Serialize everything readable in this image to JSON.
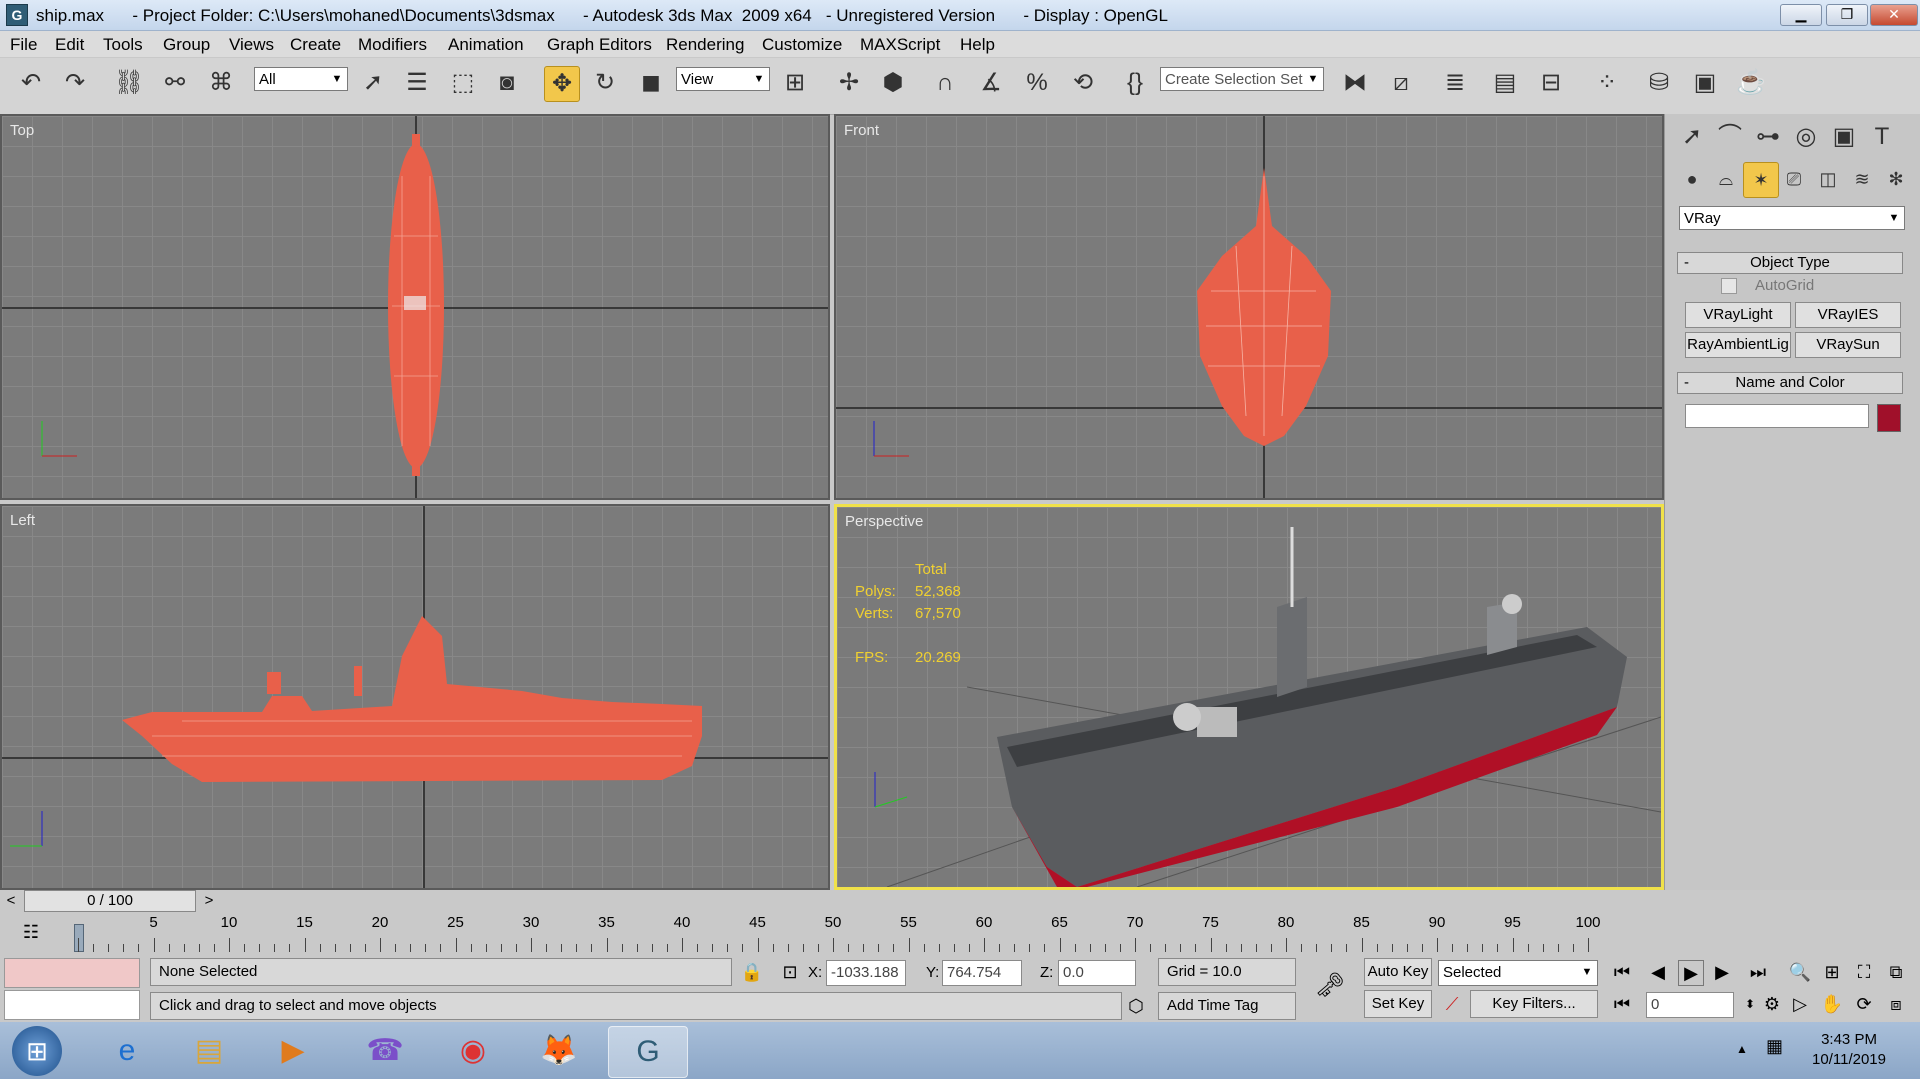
{
  "window": {
    "title": "ship.max      - Project Folder: C:\\Users\\mohaned\\Documents\\3dsmax      - Autodesk 3ds Max  2009 x64   - Unregistered Version      - Display : OpenGL",
    "minimize": "▁",
    "maximize": "❐",
    "close": "✕"
  },
  "menu": [
    "File",
    "Edit",
    "Tools",
    "Group",
    "Views",
    "Create",
    "Modifiers",
    "Animation",
    "Graph Editors",
    "Rendering",
    "Customize",
    "MAXScript",
    "Help"
  ],
  "toolbar": {
    "selection_filter": "All",
    "reference_coord": "View",
    "selection_set_placeholder": "Create Selection Set"
  },
  "viewports": {
    "top": "Top",
    "front": "Front",
    "left": "Left",
    "perspective": "Perspective",
    "stats": {
      "header": "Total",
      "polys_label": "Polys:",
      "polys_value": "52,368",
      "verts_label": "Verts:",
      "verts_value": "67,570",
      "fps_label": "FPS:",
      "fps_value": "20.269"
    }
  },
  "command_panel": {
    "category": "VRay",
    "object_type_title": "Object Type",
    "autogrid": "AutoGrid",
    "buttons": [
      "VRayLight",
      "VRayIES",
      "RayAmbientLig",
      "VRaySun"
    ],
    "name_color_title": "Name and Color",
    "name_value": "",
    "swatch_color": "#a0102a"
  },
  "timeline": {
    "position": "0 / 100",
    "ticks": [
      "5",
      "10",
      "15",
      "20",
      "25",
      "30",
      "35",
      "40",
      "45",
      "50",
      "55",
      "60",
      "65",
      "70",
      "75",
      "80",
      "85",
      "90",
      "95",
      "100"
    ]
  },
  "status": {
    "selection": "None Selected",
    "prompt": "Click and drag to select and move objects",
    "x_label": "X:",
    "x_value": "-1033.188",
    "y_label": "Y:",
    "y_value": "764.754",
    "z_label": "Z:",
    "z_value": "0.0",
    "grid": "Grid = 10.0",
    "add_time_tag": "Add Time Tag",
    "auto_key": "Auto Key",
    "set_key": "Set Key",
    "key_mode": "Selected",
    "key_filters": "Key Filters...",
    "frame": "0"
  },
  "taskbar": {
    "time": "3:43 PM",
    "date": "10/11/2019"
  },
  "colors": {
    "wireframe": "#e8604a",
    "active_border": "#f0e14a",
    "stats_text": "#f0d030"
  }
}
